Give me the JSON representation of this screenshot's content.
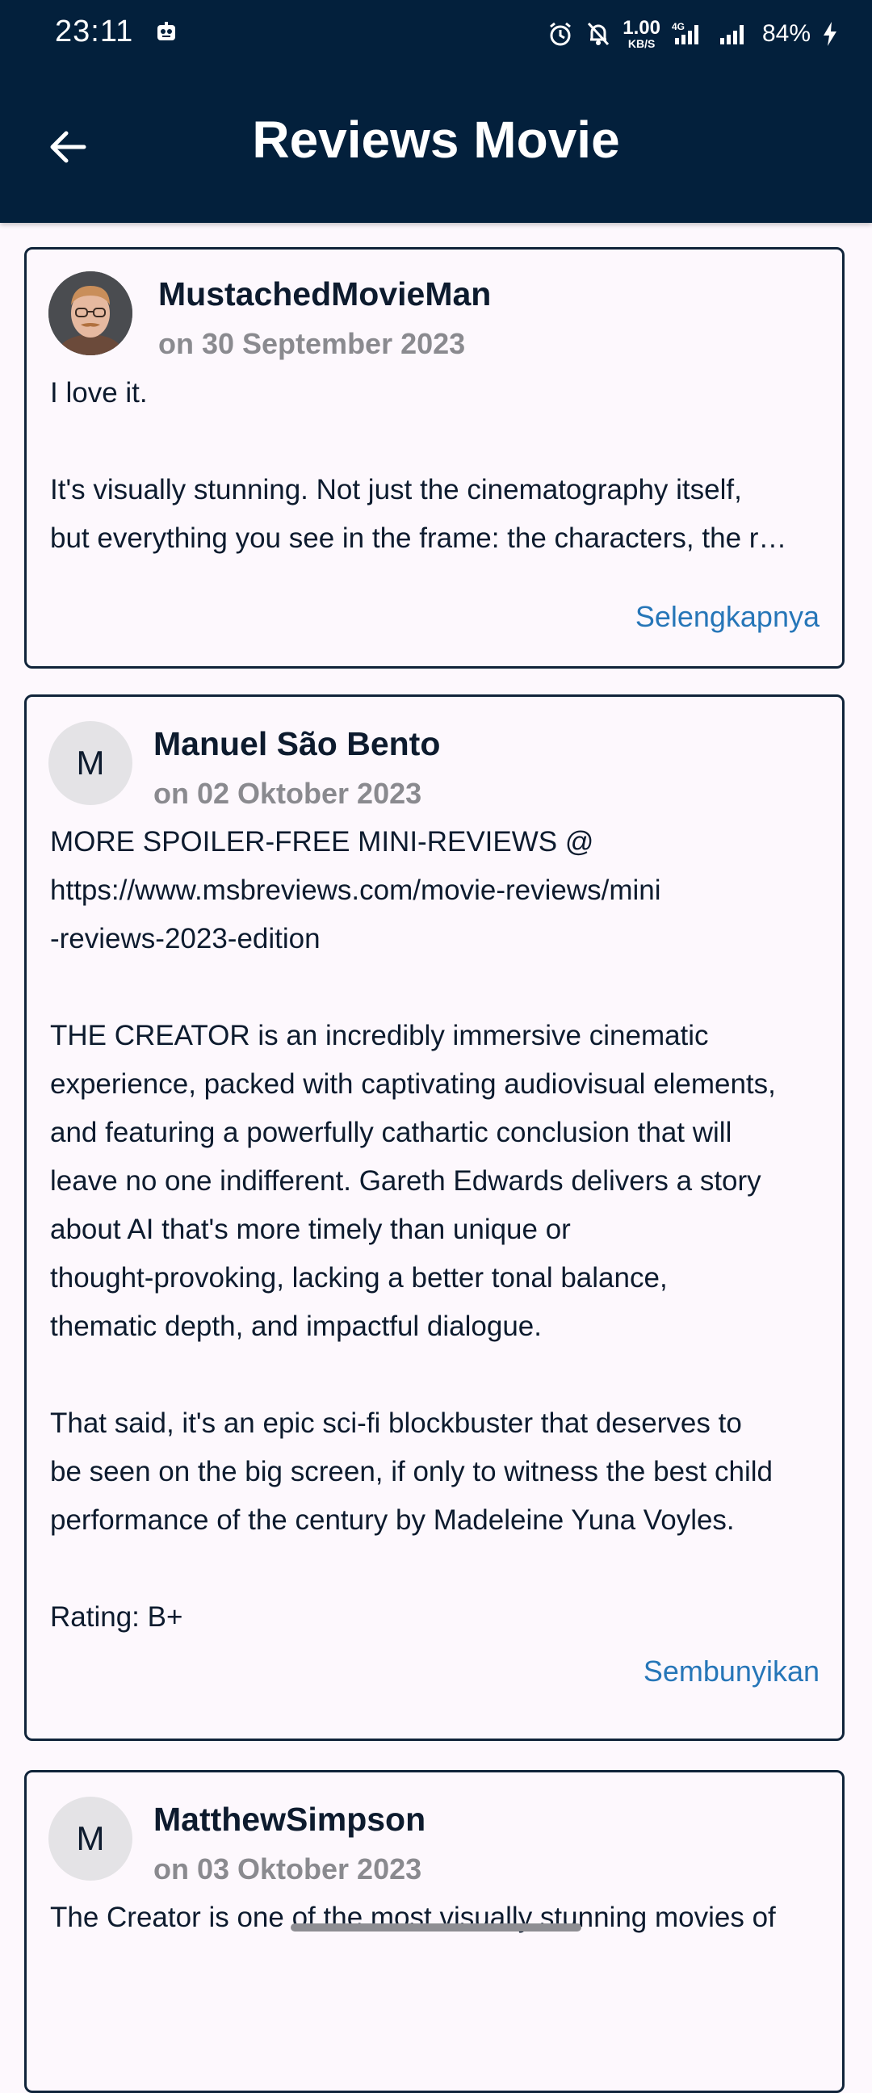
{
  "status_bar": {
    "time": "23:11",
    "net_speed_value": "1.00",
    "net_speed_unit": "KB/S",
    "network_type": "4G",
    "battery": "84%",
    "icons": [
      "app-notification-icon",
      "alarm-icon",
      "bell-muted-icon",
      "signal-4g-icon",
      "signal-icon",
      "charging-icon"
    ]
  },
  "header": {
    "title": "Reviews Movie",
    "back_icon": "arrow-left-icon"
  },
  "reviews": [
    {
      "author": "MustachedMovieMan",
      "date": "on 30 September 2023",
      "avatar_type": "photo",
      "text_lines": [
        "I love it.",
        "",
        "It's visually stunning. Not just the cinematography itself,",
        "but everything you see in the frame: the characters, the r…"
      ],
      "toggle_label": "Selengkapnya"
    },
    {
      "author": "Manuel São Bento",
      "date": "on 02 Oktober 2023",
      "avatar_type": "letter",
      "avatar_letter": "M",
      "text_lines": [
        "MORE SPOILER-FREE MINI-REVIEWS @",
        "https://www.msbreviews.com/movie-reviews/mini",
        "-reviews-2023-edition",
        "",
        "THE CREATOR is an incredibly immersive cinematic",
        "experience, packed with captivating audiovisual elements,",
        "and featuring a powerfully cathartic conclusion that will",
        "leave no one indifferent. Gareth Edwards delivers a story",
        "about AI that's more timely than unique or",
        "thought-provoking, lacking a better tonal balance,",
        "thematic depth, and impactful dialogue.",
        "",
        "That said, it's an epic sci-fi blockbuster that deserves to",
        "be seen on the big screen, if only to witness the best child",
        "performance of the century by Madeleine Yuna Voyles.",
        "",
        "Rating: B+"
      ],
      "toggle_label": "Sembunyikan"
    },
    {
      "author": "MatthewSimpson",
      "date": "on 03 Oktober 2023",
      "avatar_type": "letter",
      "avatar_letter": "M",
      "text_lines": [
        "The Creator is one of the most visually stunning movies of"
      ]
    }
  ],
  "colors": {
    "topbar": "#03203c",
    "background": "#fdf8fd",
    "card_border": "#10243a",
    "link": "#2676b8",
    "date_text": "#8a8a8f",
    "avatar_bg": "#e4e3e6"
  }
}
